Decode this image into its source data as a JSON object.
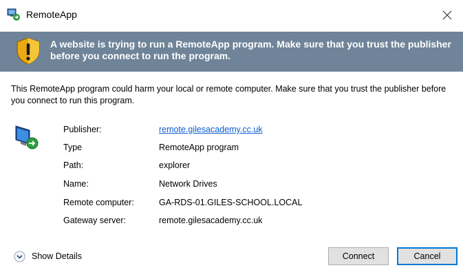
{
  "window": {
    "title": "RemoteApp",
    "app_icon": "remoteapp-icon",
    "close_icon": "close-icon"
  },
  "banner": {
    "icon": "shield-warning-icon",
    "message": "A website is trying to run a RemoteApp program. Make sure that you trust the publisher before you connect to run the program.",
    "background_color": "#6f8499"
  },
  "warning_text": "This RemoteApp program could harm your local or remote computer. Make sure that you trust the publisher before you connect to run this program.",
  "details_icon": "remote-computer-icon",
  "details": [
    {
      "label": "Publisher:",
      "value": "remote.gilesacademy.cc.uk",
      "link": true
    },
    {
      "label": "Type",
      "value": "RemoteApp program",
      "link": false
    },
    {
      "label": "Path:",
      "value": "explorer",
      "link": false
    },
    {
      "label": "Name:",
      "value": "Network Drives",
      "link": false
    },
    {
      "label": "Remote computer:",
      "value": "GA-RDS-01.GILES-SCHOOL.LOCAL",
      "link": false
    },
    {
      "label": "Gateway server:",
      "value": "remote.gilesacademy.cc.uk",
      "link": false
    }
  ],
  "footer": {
    "show_details_label": "Show Details",
    "show_details_icon": "chevron-down-circle-icon",
    "connect_label": "Connect",
    "cancel_label": "Cancel",
    "focus_color": "#0078d7"
  }
}
